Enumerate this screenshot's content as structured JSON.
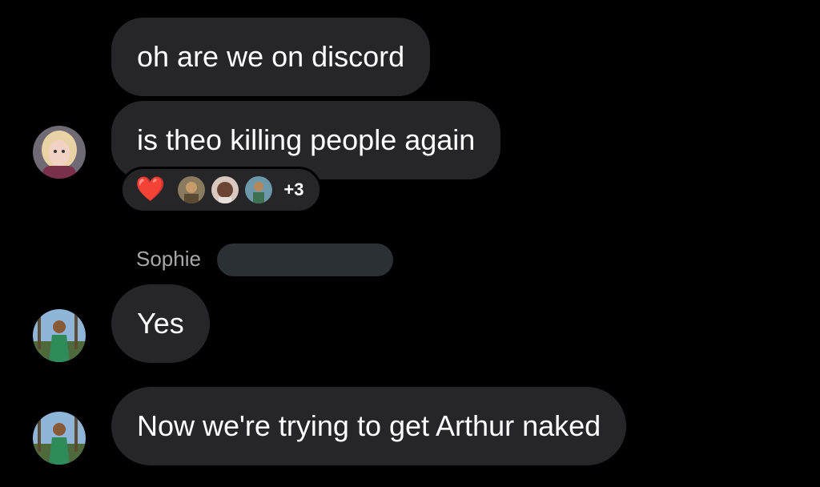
{
  "messages": [
    {
      "text": "oh are we on discord"
    },
    {
      "text": "is theo killing people again"
    },
    {
      "text": "Yes"
    },
    {
      "text": "Now we're trying to get Arthur naked"
    }
  ],
  "reactions": {
    "emoji": "❤️",
    "count_label": "+3"
  },
  "sender": {
    "name": "Sophie"
  },
  "colors": {
    "background": "#000000",
    "bubble": "#262628",
    "sender_text": "#a8a8aa",
    "redaction": "#2b3035"
  },
  "icons": {
    "avatar_1": "avatar-blonde-woman-icon",
    "avatar_2": "avatar-woman-green-dress-icon",
    "avatar_3": "avatar-woman-green-dress-icon"
  }
}
